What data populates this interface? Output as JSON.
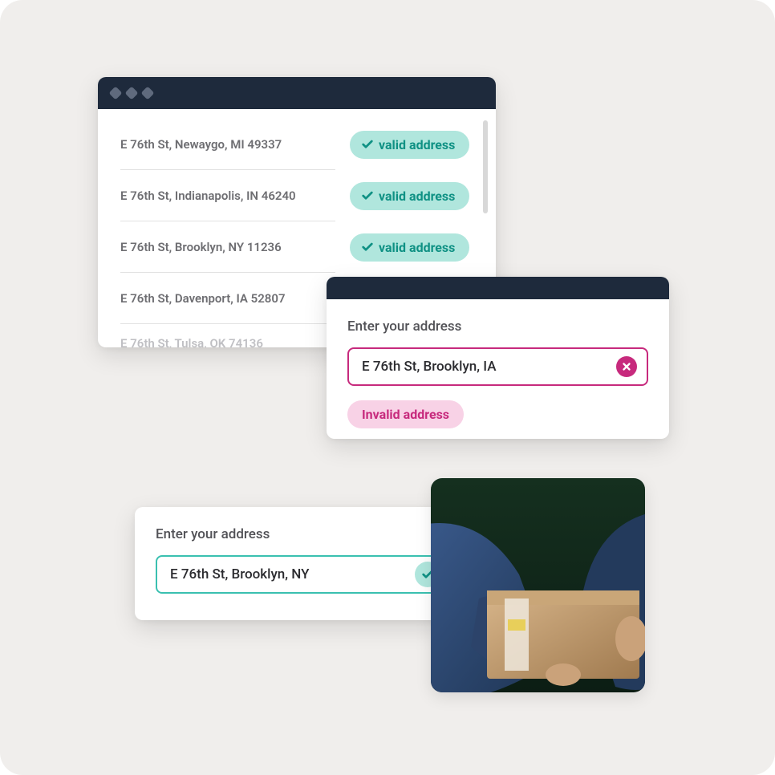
{
  "colors": {
    "navy": "#1e2a3c",
    "teal_bg": "#b0e6dd",
    "teal_text": "#0f9184",
    "teal_border": "#3ac0b0",
    "pink_bg": "#f8d2e6",
    "pink_text": "#c72a7d"
  },
  "validation_list": {
    "valid_label": "valid address",
    "rows": [
      {
        "address": "E 76th St, Newaygo, MI 49337",
        "status": "valid"
      },
      {
        "address": "E 76th St, Indianapolis, IN 46240",
        "status": "valid"
      },
      {
        "address": "E 76th St, Brooklyn, NY 11236",
        "status": "valid"
      },
      {
        "address": "E 76th St, Davenport, IA 52807",
        "status": "pending"
      },
      {
        "address": "E 76th St, Tulsa, OK 74136",
        "status": "pending"
      }
    ]
  },
  "invalid_entry": {
    "label": "Enter your address",
    "value": "E 76th St, Brooklyn, IA",
    "badge": "Invalid address"
  },
  "valid_entry": {
    "label": "Enter your address",
    "value": "E 76th St, Brooklyn, NY"
  }
}
